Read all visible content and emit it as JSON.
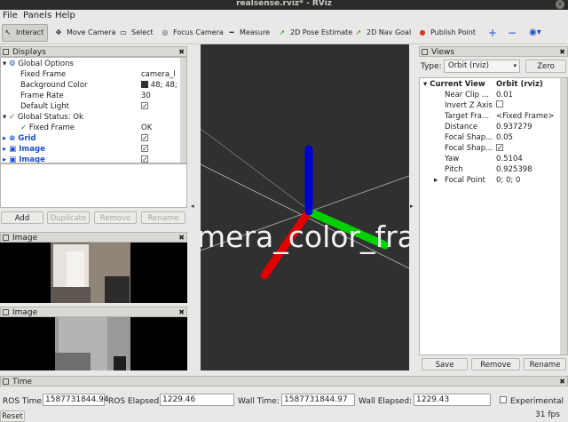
{
  "window": {
    "title": "realsense.rviz* - RViz",
    "close_glyph": "✕"
  },
  "menu": {
    "file": "File",
    "panels": "Panels",
    "help": "Help"
  },
  "toolbar": {
    "interact": "Interact",
    "move_camera": "Move Camera",
    "select": "Select",
    "focus_camera": "Focus Camera",
    "measure": "Measure",
    "pose_estimate": "2D Pose Estimate",
    "nav_goal": "2D Nav Goal",
    "publish_point": "Publish Point",
    "plus": "+",
    "minus": "−"
  },
  "displays": {
    "header": "Displays",
    "rows": {
      "global_options": "Global Options",
      "fixed_frame_label": "Fixed Frame",
      "fixed_frame_value": "camera_l",
      "background_label": "Background Color",
      "background_value": "48; 48;",
      "frame_rate_label": "Frame Rate",
      "frame_rate_value": "30",
      "default_light_label": "Default Light",
      "global_status": "Global Status: Ok",
      "status_fixed_frame": "Fixed Frame",
      "status_fixed_frame_value": "OK",
      "grid": "Grid",
      "image1": "Image",
      "image2": "Image"
    },
    "buttons": {
      "add": "Add",
      "duplicate": "Duplicate",
      "remove": "Remove",
      "rename": "Rename"
    }
  },
  "image_panels": {
    "first": "Image",
    "second": "Image"
  },
  "viewport": {
    "frame_label": "mera_color_fra"
  },
  "views": {
    "header": "Views",
    "type_label": "Type:",
    "type_value": "Orbit (rviz)",
    "zero": "Zero",
    "current_view": "Current View",
    "current_view_value": "Orbit (rviz)",
    "props": [
      {
        "k": "Near Clip ...",
        "v": "0.01"
      },
      {
        "k": "Invert Z Axis",
        "v": ""
      },
      {
        "k": "Target Fra...",
        "v": "<Fixed Frame>"
      },
      {
        "k": "Distance",
        "v": "0.937279"
      },
      {
        "k": "Focal Shap...",
        "v": "0.05"
      },
      {
        "k": "Focal Shap...",
        "v": "✓"
      },
      {
        "k": "Yaw",
        "v": "0.5104"
      },
      {
        "k": "Pitch",
        "v": "0.925398"
      },
      {
        "k": "Focal Point",
        "v": "0; 0; 0"
      }
    ],
    "buttons": {
      "save": "Save",
      "remove": "Remove",
      "rename": "Rename"
    }
  },
  "time": {
    "header": "Time",
    "ros_time_label": "ROS Time:",
    "ros_time": "1587731844.94",
    "ros_elapsed_label": "ROS Elapsed:",
    "ros_elapsed": "1229.46",
    "wall_time_label": "Wall Time:",
    "wall_time": "1587731844.97",
    "wall_elapsed_label": "Wall Elapsed:",
    "wall_elapsed": "1229.43",
    "experimental": "Experimental",
    "reset": "Reset",
    "fps": "31 fps"
  },
  "colors": {
    "viewport_bg": "#303030",
    "x_axis": "#e00000",
    "y_axis": "#00d000",
    "z_axis": "#0000d0",
    "link_blue": "#1a4fd0"
  }
}
